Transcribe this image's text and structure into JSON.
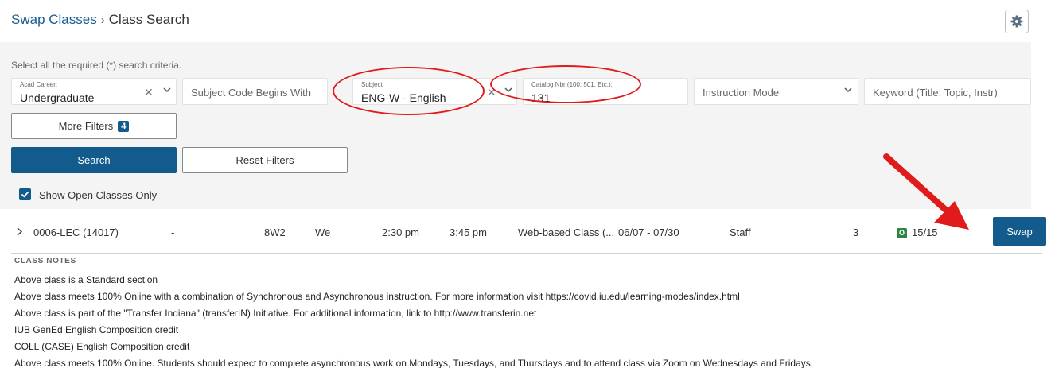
{
  "header": {
    "breadcrumb_link": "Swap Classes",
    "separator": "›",
    "breadcrumb_current": "Class Search"
  },
  "icons": {
    "settings": "gear-icon",
    "clear": "close-icon",
    "dropdown": "chevron-down-icon",
    "expand": "chevron-right-icon",
    "check": "checkmark-icon",
    "open_status": "open-seat-icon"
  },
  "search": {
    "instructions": "Select all the required (*) search criteria.",
    "acad_career": {
      "label": "Acad Career:",
      "value": "Undergraduate"
    },
    "subject_code": {
      "placeholder": "Subject Code Begins With"
    },
    "subject": {
      "label": "Subject:",
      "value": "ENG-W - English"
    },
    "catalog_nbr": {
      "label": "Catalog Nbr (100, 501, Etc.):",
      "value": "131"
    },
    "instruction_mode": {
      "placeholder": "Instruction Mode"
    },
    "keyword": {
      "placeholder": "Keyword (Title, Topic, Instr)"
    },
    "more_filters_label": "More Filters",
    "more_filters_count": "4",
    "search_label": "Search",
    "reset_label": "Reset Filters",
    "open_only_label": "Show Open Classes Only",
    "open_only_checked": true
  },
  "result": {
    "section": "0006-LEC (14017)",
    "dash": "-",
    "session": "8W2",
    "days": "We",
    "start_time": "2:30 pm",
    "end_time": "3:45 pm",
    "location": "Web-based Class (...",
    "dates": "06/07 - 07/30",
    "instructor": "Staff",
    "units": "3",
    "status_code": "O",
    "seats": "15/15",
    "swap_label": "Swap"
  },
  "notes": {
    "heading": "CLASS NOTES",
    "lines": [
      "Above class is a Standard section",
      "Above class meets 100% Online with a combination of Synchronous and Asynchronous instruction. For more information visit https://covid.iu.edu/learning-modes/index.html",
      "Above class is part of the \"Transfer Indiana\" (transferIN) Initiative. For additional information, link to http://www.transferin.net",
      "IUB GenEd English Composition credit",
      "COLL (CASE) English Composition credit",
      "Above class meets 100% Online. Students should expect to complete asynchronous work on Mondays, Tuesdays, and Thursdays and to attend class via Zoom on Wednesdays and Fridays."
    ]
  },
  "colors": {
    "primary": "#135b8c",
    "link": "#1a5c8f",
    "annotation": "#e01b1b",
    "open_status": "#2e8540",
    "panel_bg": "#f4f4f4"
  }
}
